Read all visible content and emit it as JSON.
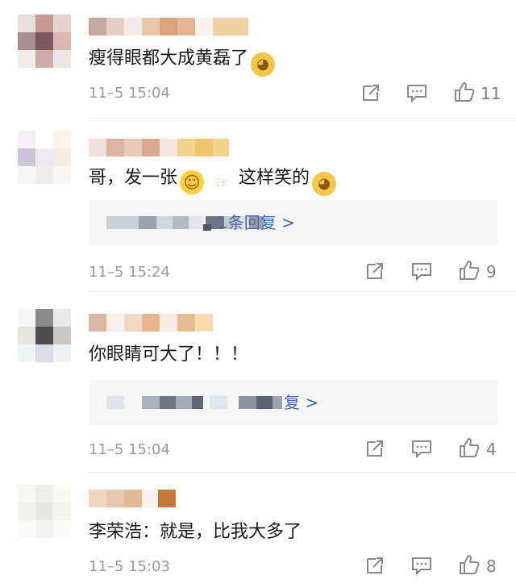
{
  "comments": [
    {
      "text_before": "瘦得眼都大成黄磊了",
      "emoji": "doge-emoji",
      "time": "11–5 15:04",
      "likes": "11"
    },
    {
      "text_part1": "哥，发一张",
      "text_part2": "这样笑的",
      "time": "11–5 15:24",
      "likes": "9",
      "reply_link": "1条回复 >"
    },
    {
      "text": "你眼睛可大了！！！",
      "time": "11–5 15:04",
      "likes": "4",
      "reply_link": "复 >"
    },
    {
      "text": "李荣浩：就是，比我大多了",
      "time": "11–5 15:03",
      "likes": "8"
    }
  ],
  "icons": {
    "share": "share-icon",
    "comment": "comment-icon",
    "like": "thumbs-up-icon"
  },
  "colors": {
    "link": "#4a68a6",
    "meta": "#999999"
  }
}
